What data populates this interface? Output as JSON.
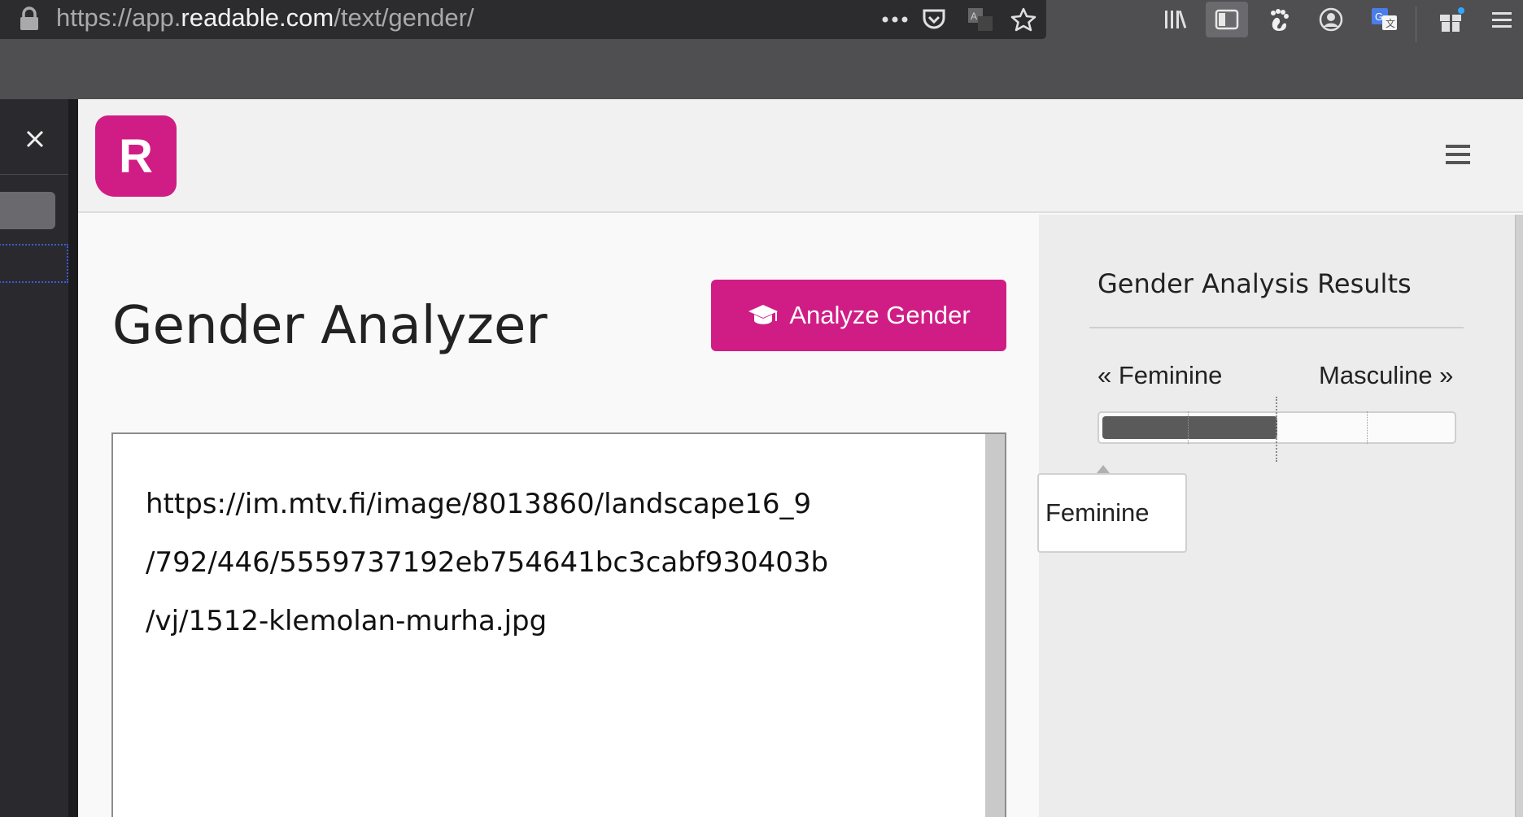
{
  "browser": {
    "url_prefix": "https://app.",
    "url_domain": "readable.com",
    "url_path": "/text/gender/"
  },
  "app": {
    "logo_letter": "R",
    "brand_color": "#d01d85"
  },
  "main": {
    "title": "Gender Analyzer",
    "analyze_button": "Analyze Gender",
    "text_lines": [
      "https://im.mtv.fi/image/8013860/landscape16_9",
      "/792/446/5559737192eb754641bc3cabf930403b",
      "/vj/1512-klemolan-murha.jpg"
    ]
  },
  "results": {
    "title": "Gender Analysis Results",
    "label_feminine": "« Feminine",
    "label_masculine": "Masculine »",
    "bar_level": 0.5,
    "verdict": "Feminine"
  },
  "icons": [
    "lock-icon",
    "more-icon",
    "pocket-icon",
    "translate-icon",
    "bookmark-star-icon",
    "library-icon",
    "reader-view-icon",
    "gnome-icon",
    "account-icon",
    "google-translate-icon",
    "gift-icon",
    "menu-icon",
    "close-icon",
    "graduation-cap-icon",
    "hamburger-icon"
  ]
}
